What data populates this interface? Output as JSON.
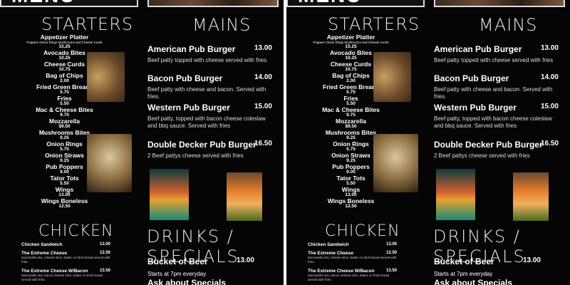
{
  "menu": {
    "title": "MENU",
    "sections": {
      "starters": "STARTERS",
      "mains": "MAINS",
      "chicken": "CHICKEN",
      "drinks": "DRINKS / SPECIALS"
    },
    "starters": [
      {
        "name": "Appetizer Platter",
        "sub": "Poppers Onion Rings Mushrooms and Cheese Curds",
        "price": "15.25"
      },
      {
        "name": "Avocado Bites",
        "price": "10.25"
      },
      {
        "name": "Cheese Curds",
        "price": "10.75"
      },
      {
        "name": "Bag of Chips",
        "price": "2.00"
      },
      {
        "name": "Fried Green Breans",
        "price": "5.75"
      },
      {
        "name": "Fries",
        "price": "5.50"
      },
      {
        "name": "Mac & Cheese Bites",
        "price": "9.75"
      },
      {
        "name": "Mozzarella",
        "price": "$9.50"
      },
      {
        "name": "Mushrooms Bites",
        "price": "9.25"
      },
      {
        "name": "Onion Rings",
        "price": "5.75"
      },
      {
        "name": "Onion  Straws",
        "price": "9.25"
      },
      {
        "name": "Pub Poppers",
        "price": "9.00"
      },
      {
        "name": "Tator Tots",
        "price": "5.50"
      },
      {
        "name": "Wings",
        "price": "13.00"
      },
      {
        "name": "Wings Boneless",
        "price": "12.50"
      }
    ],
    "mains": [
      {
        "name": "American Pub Burger",
        "price": "13.00",
        "desc": "Beef patty topped with cheese served with fries"
      },
      {
        "name": "Bacon Pub Burger",
        "price": "14.00",
        "desc": "Beef patty with cheese and bacon. Served with fries."
      },
      {
        "name": "Western Pub Burger",
        "price": "15.00",
        "desc": "Beef patty, topped with bacon cheese coleslaw and bbq sauce. Served with fries"
      },
      {
        "name": "Double Decker Pub Burger",
        "price": "16.50",
        "desc": "2 Beef pattys cheese served with fries"
      }
    ],
    "chicken": [
      {
        "name": "Chicken Sandwich",
        "price": "13.00",
        "desc": ""
      },
      {
        "name": "The Extreme Cheese",
        "price": "12.50",
        "desc": "Mozzarella stix, cheese slice, butter on thick bread served with fries."
      },
      {
        "name": "The Extreme Cheese W/Bacon",
        "price": "13.50",
        "desc": "Mozzarella stix, bacon cheese slice, butter on thick bread served with fries."
      }
    ],
    "drinks": {
      "bucket_name": "Bucket of Beer",
      "bucket_price": "13.00",
      "bucket_desc": "Starts at 7pm everyday",
      "ask": "Ask about Specials"
    }
  }
}
